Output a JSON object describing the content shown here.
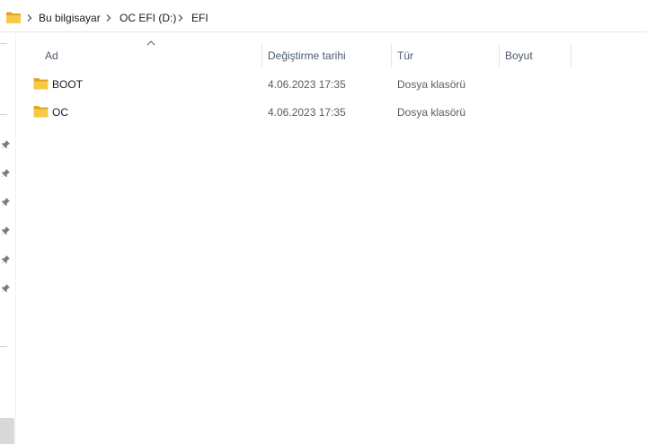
{
  "address_bar": {
    "icon": "folder-icon",
    "breadcrumb": [
      "Bu bilgisayar",
      "OC EFI (D:)",
      "EFI"
    ]
  },
  "nav_pane": {
    "pin_icon": "pin-icon",
    "pin_count": 6
  },
  "columns": {
    "name": "Ad",
    "modified": "Değiştirme tarihi",
    "type": "Tür",
    "size": "Boyut",
    "sorted_by": "name"
  },
  "files": [
    {
      "name": "BOOT",
      "modified": "4.06.2023 17:35",
      "type": "Dosya klasörü",
      "size": "",
      "icon": "folder-icon"
    },
    {
      "name": "OC",
      "modified": "4.06.2023 17:35",
      "type": "Dosya klasörü",
      "size": "",
      "icon": "folder-icon"
    }
  ],
  "colors": {
    "folder_yellow": "#f8c948",
    "folder_dark": "#e0a420",
    "header_text": "#4c5a6b",
    "divider": "#e5e5e5"
  }
}
